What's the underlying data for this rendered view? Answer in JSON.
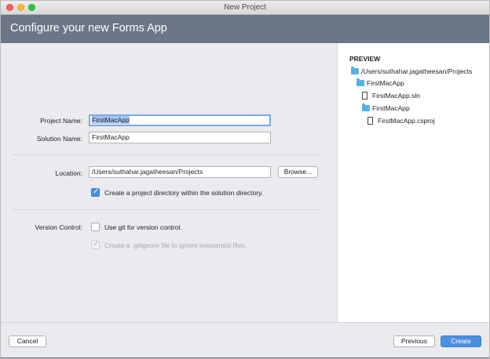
{
  "window": {
    "title": "New Project"
  },
  "banner": {
    "title": "Configure your new Forms App"
  },
  "form": {
    "project_name_label": "Project Name:",
    "project_name_value": "FirstMacApp",
    "solution_name_label": "Solution Name:",
    "solution_name_value": "FirstMacApp",
    "location_label": "Location:",
    "location_value": "/Users/suthahar.jagatheesan/Projects",
    "browse_label": "Browse...",
    "create_dir_label": "Create a project directory within the solution directory.",
    "create_dir_checked": true,
    "version_control_label": "Version Control:",
    "use_git_label": "Use git for version control.",
    "use_git_checked": false,
    "gitignore_label": "Create a .gitignore file to ignore inessential files.",
    "gitignore_checked": true,
    "gitignore_enabled": false
  },
  "preview": {
    "heading": "PREVIEW",
    "tree": [
      {
        "type": "folder",
        "name": "/Users/suthahar.jagatheesan/Projects"
      },
      {
        "type": "folder",
        "name": "FirstMacApp"
      },
      {
        "type": "file",
        "name": "FirstMacApp.sln"
      },
      {
        "type": "folder",
        "name": "FirstMacApp"
      },
      {
        "type": "file",
        "name": "FirstMacApp.csproj"
      }
    ]
  },
  "footer": {
    "cancel_label": "Cancel",
    "previous_label": "Previous",
    "create_label": "Create"
  },
  "colors": {
    "banner": "#6b7687",
    "accent": "#4a90e2",
    "folder": "#56b3e6"
  }
}
